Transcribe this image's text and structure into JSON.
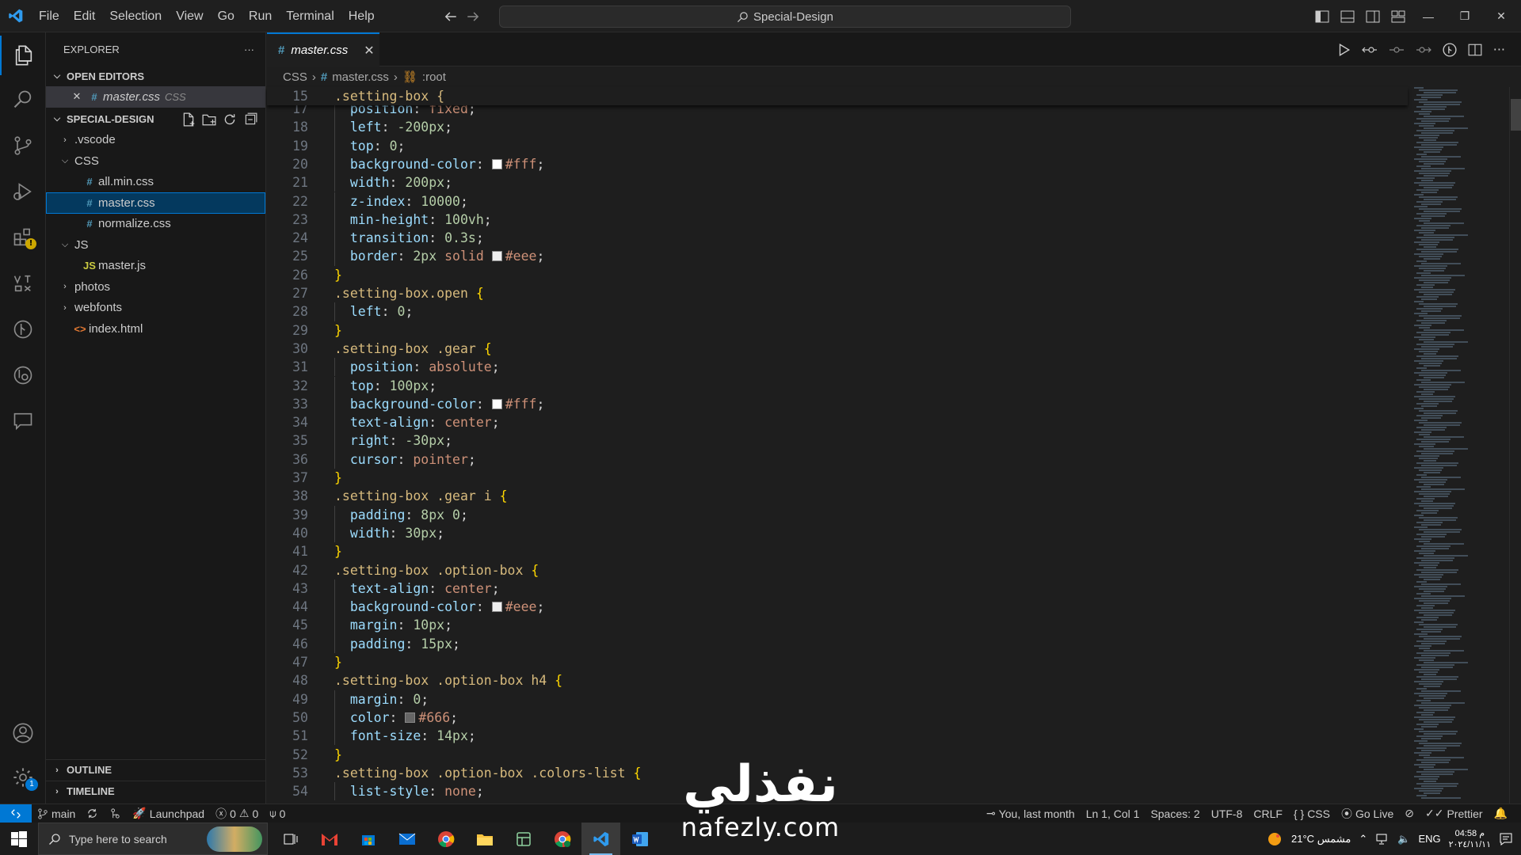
{
  "titlebar": {
    "menu": [
      "File",
      "Edit",
      "Selection",
      "View",
      "Go",
      "Run",
      "Terminal",
      "Help"
    ],
    "command_center": "Special-Design"
  },
  "sidebar": {
    "title": "EXPLORER",
    "more": "···",
    "open_editors_label": "OPEN EDITORS",
    "open_editor": {
      "name": "master.css",
      "lang": "CSS"
    },
    "project_label": "SPECIAL-DESIGN",
    "tree": [
      {
        "name": ".vscode",
        "type": "folder",
        "depth": 0,
        "expanded": false
      },
      {
        "name": "CSS",
        "type": "folder",
        "depth": 0,
        "expanded": true
      },
      {
        "name": "all.min.css",
        "type": "css",
        "depth": 1
      },
      {
        "name": "master.css",
        "type": "css",
        "depth": 1,
        "selected": true
      },
      {
        "name": "normalize.css",
        "type": "css",
        "depth": 1
      },
      {
        "name": "JS",
        "type": "folder",
        "depth": 0,
        "expanded": true
      },
      {
        "name": "master.js",
        "type": "js",
        "depth": 1
      },
      {
        "name": "photos",
        "type": "folder",
        "depth": 0,
        "expanded": false
      },
      {
        "name": "webfonts",
        "type": "folder",
        "depth": 0,
        "expanded": false
      },
      {
        "name": "index.html",
        "type": "html",
        "depth": 0
      }
    ],
    "outline_label": "OUTLINE",
    "timeline_label": "TIMELINE"
  },
  "tab": {
    "name": "master.css"
  },
  "breadcrumb": {
    "folder": "CSS",
    "file": "master.css",
    "symbol": ":root"
  },
  "code": {
    "sticky": {
      "line": 15,
      "text": ".setting-box {"
    },
    "lines": [
      {
        "n": 17,
        "t": [
          [
            "i",
            "  "
          ],
          [
            "p",
            "position"
          ],
          [
            "c",
            ": "
          ],
          [
            "v",
            "fixed"
          ],
          [
            "c",
            ";"
          ]
        ]
      },
      {
        "n": 18,
        "t": [
          [
            "i",
            "  "
          ],
          [
            "p",
            "left"
          ],
          [
            "c",
            ": "
          ],
          [
            "n",
            "-200px"
          ],
          [
            "c",
            ";"
          ]
        ]
      },
      {
        "n": 19,
        "t": [
          [
            "i",
            "  "
          ],
          [
            "p",
            "top"
          ],
          [
            "c",
            ": "
          ],
          [
            "n",
            "0"
          ],
          [
            "c",
            ";"
          ]
        ]
      },
      {
        "n": 20,
        "t": [
          [
            "i",
            "  "
          ],
          [
            "p",
            "background-color"
          ],
          [
            "c",
            ": "
          ],
          [
            "sw",
            "#ffffff"
          ],
          [
            "v",
            "#fff"
          ],
          [
            "c",
            ";"
          ]
        ]
      },
      {
        "n": 21,
        "t": [
          [
            "i",
            "  "
          ],
          [
            "p",
            "width"
          ],
          [
            "c",
            ": "
          ],
          [
            "n",
            "200px"
          ],
          [
            "c",
            ";"
          ]
        ]
      },
      {
        "n": 22,
        "t": [
          [
            "i",
            "  "
          ],
          [
            "p",
            "z-index"
          ],
          [
            "c",
            ": "
          ],
          [
            "n",
            "10000"
          ],
          [
            "c",
            ";"
          ]
        ]
      },
      {
        "n": 23,
        "t": [
          [
            "i",
            "  "
          ],
          [
            "p",
            "min-height"
          ],
          [
            "c",
            ": "
          ],
          [
            "n",
            "100vh"
          ],
          [
            "c",
            ";"
          ]
        ]
      },
      {
        "n": 24,
        "t": [
          [
            "i",
            "  "
          ],
          [
            "p",
            "transition"
          ],
          [
            "c",
            ": "
          ],
          [
            "n",
            "0.3s"
          ],
          [
            "c",
            ";"
          ]
        ]
      },
      {
        "n": 25,
        "t": [
          [
            "i",
            "  "
          ],
          [
            "p",
            "border"
          ],
          [
            "c",
            ": "
          ],
          [
            "n",
            "2px"
          ],
          [
            "c",
            " "
          ],
          [
            "v",
            "solid"
          ],
          [
            "c",
            " "
          ],
          [
            "sw",
            "#eeeeee"
          ],
          [
            "v",
            "#eee"
          ],
          [
            "c",
            ";"
          ]
        ]
      },
      {
        "n": 26,
        "t": [
          [
            "b",
            "}"
          ]
        ]
      },
      {
        "n": 27,
        "t": [
          [
            "s",
            ".setting-box.open"
          ],
          [
            "c",
            " "
          ],
          [
            "b",
            "{"
          ]
        ]
      },
      {
        "n": 28,
        "t": [
          [
            "i",
            "  "
          ],
          [
            "p",
            "left"
          ],
          [
            "c",
            ": "
          ],
          [
            "n",
            "0"
          ],
          [
            "c",
            ";"
          ]
        ]
      },
      {
        "n": 29,
        "t": [
          [
            "b",
            "}"
          ]
        ]
      },
      {
        "n": 30,
        "t": [
          [
            "s",
            ".setting-box .gear"
          ],
          [
            "c",
            " "
          ],
          [
            "b",
            "{"
          ]
        ]
      },
      {
        "n": 31,
        "t": [
          [
            "i",
            "  "
          ],
          [
            "p",
            "position"
          ],
          [
            "c",
            ": "
          ],
          [
            "v",
            "absolute"
          ],
          [
            "c",
            ";"
          ]
        ]
      },
      {
        "n": 32,
        "t": [
          [
            "i",
            "  "
          ],
          [
            "p",
            "top"
          ],
          [
            "c",
            ": "
          ],
          [
            "n",
            "100px"
          ],
          [
            "c",
            ";"
          ]
        ]
      },
      {
        "n": 33,
        "t": [
          [
            "i",
            "  "
          ],
          [
            "p",
            "background-color"
          ],
          [
            "c",
            ": "
          ],
          [
            "sw",
            "#ffffff"
          ],
          [
            "v",
            "#fff"
          ],
          [
            "c",
            ";"
          ]
        ]
      },
      {
        "n": 34,
        "t": [
          [
            "i",
            "  "
          ],
          [
            "p",
            "text-align"
          ],
          [
            "c",
            ": "
          ],
          [
            "v",
            "center"
          ],
          [
            "c",
            ";"
          ]
        ]
      },
      {
        "n": 35,
        "t": [
          [
            "i",
            "  "
          ],
          [
            "p",
            "right"
          ],
          [
            "c",
            ": "
          ],
          [
            "n",
            "-30px"
          ],
          [
            "c",
            ";"
          ]
        ]
      },
      {
        "n": 36,
        "t": [
          [
            "i",
            "  "
          ],
          [
            "p",
            "cursor"
          ],
          [
            "c",
            ": "
          ],
          [
            "v",
            "pointer"
          ],
          [
            "c",
            ";"
          ]
        ]
      },
      {
        "n": 37,
        "t": [
          [
            "b",
            "}"
          ]
        ]
      },
      {
        "n": 38,
        "t": [
          [
            "s",
            ".setting-box .gear i"
          ],
          [
            "c",
            " "
          ],
          [
            "b",
            "{"
          ]
        ]
      },
      {
        "n": 39,
        "t": [
          [
            "i",
            "  "
          ],
          [
            "p",
            "padding"
          ],
          [
            "c",
            ": "
          ],
          [
            "n",
            "8px 0"
          ],
          [
            "c",
            ";"
          ]
        ]
      },
      {
        "n": 40,
        "t": [
          [
            "i",
            "  "
          ],
          [
            "p",
            "width"
          ],
          [
            "c",
            ": "
          ],
          [
            "n",
            "30px"
          ],
          [
            "c",
            ";"
          ]
        ]
      },
      {
        "n": 41,
        "t": [
          [
            "b",
            "}"
          ]
        ]
      },
      {
        "n": 42,
        "t": [
          [
            "s",
            ".setting-box .option-box"
          ],
          [
            "c",
            " "
          ],
          [
            "b",
            "{"
          ]
        ]
      },
      {
        "n": 43,
        "t": [
          [
            "i",
            "  "
          ],
          [
            "p",
            "text-align"
          ],
          [
            "c",
            ": "
          ],
          [
            "v",
            "center"
          ],
          [
            "c",
            ";"
          ]
        ]
      },
      {
        "n": 44,
        "t": [
          [
            "i",
            "  "
          ],
          [
            "p",
            "background-color"
          ],
          [
            "c",
            ": "
          ],
          [
            "sw",
            "#eeeeee"
          ],
          [
            "v",
            "#eee"
          ],
          [
            "c",
            ";"
          ]
        ]
      },
      {
        "n": 45,
        "t": [
          [
            "i",
            "  "
          ],
          [
            "p",
            "margin"
          ],
          [
            "c",
            ": "
          ],
          [
            "n",
            "10px"
          ],
          [
            "c",
            ";"
          ]
        ]
      },
      {
        "n": 46,
        "t": [
          [
            "i",
            "  "
          ],
          [
            "p",
            "padding"
          ],
          [
            "c",
            ": "
          ],
          [
            "n",
            "15px"
          ],
          [
            "c",
            ";"
          ]
        ]
      },
      {
        "n": 47,
        "t": [
          [
            "b",
            "}"
          ]
        ]
      },
      {
        "n": 48,
        "t": [
          [
            "s",
            ".setting-box .option-box h4"
          ],
          [
            "c",
            " "
          ],
          [
            "b",
            "{"
          ]
        ]
      },
      {
        "n": 49,
        "t": [
          [
            "i",
            "  "
          ],
          [
            "p",
            "margin"
          ],
          [
            "c",
            ": "
          ],
          [
            "n",
            "0"
          ],
          [
            "c",
            ";"
          ]
        ]
      },
      {
        "n": 50,
        "t": [
          [
            "i",
            "  "
          ],
          [
            "p",
            "color"
          ],
          [
            "c",
            ": "
          ],
          [
            "sw",
            "#666666"
          ],
          [
            "v",
            "#666"
          ],
          [
            "c",
            ";"
          ]
        ]
      },
      {
        "n": 51,
        "t": [
          [
            "i",
            "  "
          ],
          [
            "p",
            "font-size"
          ],
          [
            "c",
            ": "
          ],
          [
            "n",
            "14px"
          ],
          [
            "c",
            ";"
          ]
        ]
      },
      {
        "n": 52,
        "t": [
          [
            "b",
            "}"
          ]
        ]
      },
      {
        "n": 53,
        "t": [
          [
            "s",
            ".setting-box .option-box .colors-list"
          ],
          [
            "c",
            " "
          ],
          [
            "b",
            "{"
          ]
        ]
      },
      {
        "n": 54,
        "t": [
          [
            "i",
            "  "
          ],
          [
            "p",
            "list-style"
          ],
          [
            "c",
            ": "
          ],
          [
            "v",
            "none"
          ],
          [
            "c",
            ";"
          ]
        ]
      }
    ]
  },
  "statusbar": {
    "branch": "main",
    "launchpad": "Launchpad",
    "errors": "0",
    "warnings": "0",
    "ports": "0",
    "blame": "You, last month",
    "position": "Ln 1, Col 1",
    "spaces": "Spaces: 2",
    "encoding": "UTF-8",
    "eol": "CRLF",
    "language": "CSS",
    "golive": "Go Live",
    "prettier": "Prettier"
  },
  "taskbar": {
    "search_placeholder": "Type here to search",
    "weather": "21°C مشمس",
    "lang": "ENG",
    "time": "04:58 م",
    "date": "٢٠٢٤/١١/١١"
  },
  "watermark": {
    "arabic": "نفذلي",
    "latin": "nafezly.com"
  },
  "colors": {
    "accent": "#0078d4",
    "selector": "#d7ba7d",
    "property": "#9cdcfe",
    "value": "#ce9178",
    "number": "#b5cea8",
    "bracket": "#ffd700"
  }
}
